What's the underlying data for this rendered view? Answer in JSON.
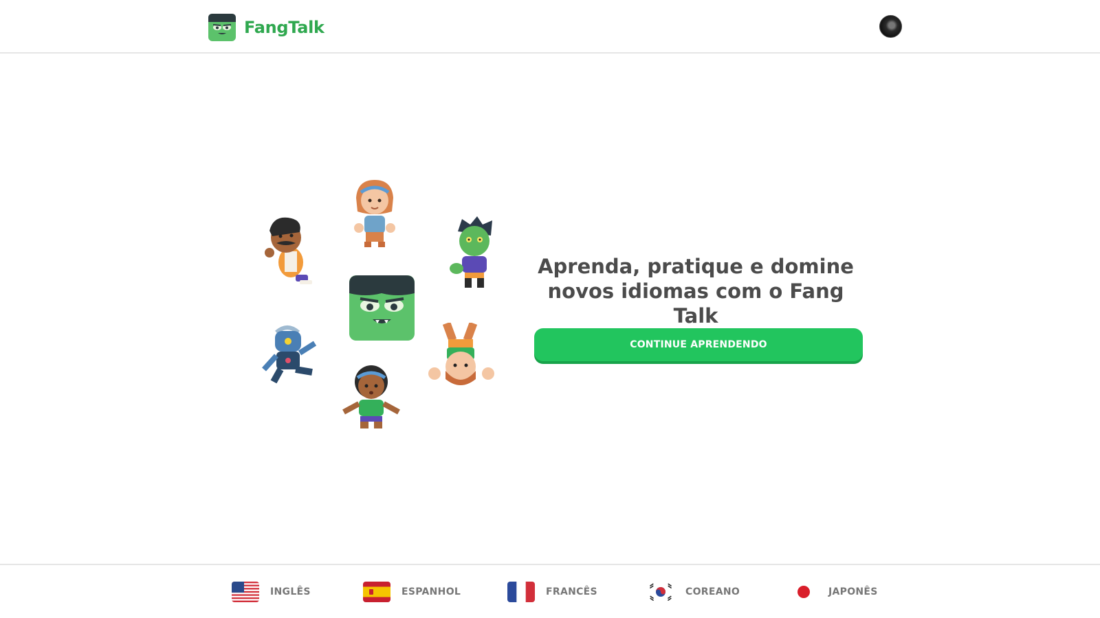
{
  "header": {
    "brand": "FangTalk",
    "brand_color": "#2fa84f"
  },
  "hero": {
    "headline": "Aprenda, pratique e domine novos idiomas com o Fang Talk",
    "cta_label": "CONTINUE APRENDENDO",
    "cta_color": "#22c55e"
  },
  "footer": {
    "languages": [
      {
        "label": "INGLÊS",
        "icon": "usa-flag-icon"
      },
      {
        "label": "ESPANHOL",
        "icon": "spain-flag-icon"
      },
      {
        "label": "FRANCÊS",
        "icon": "france-flag-icon"
      },
      {
        "label": "COREANO",
        "icon": "korea-flag-icon"
      },
      {
        "label": "JAPONÊS",
        "icon": "japan-flag-icon"
      }
    ]
  }
}
